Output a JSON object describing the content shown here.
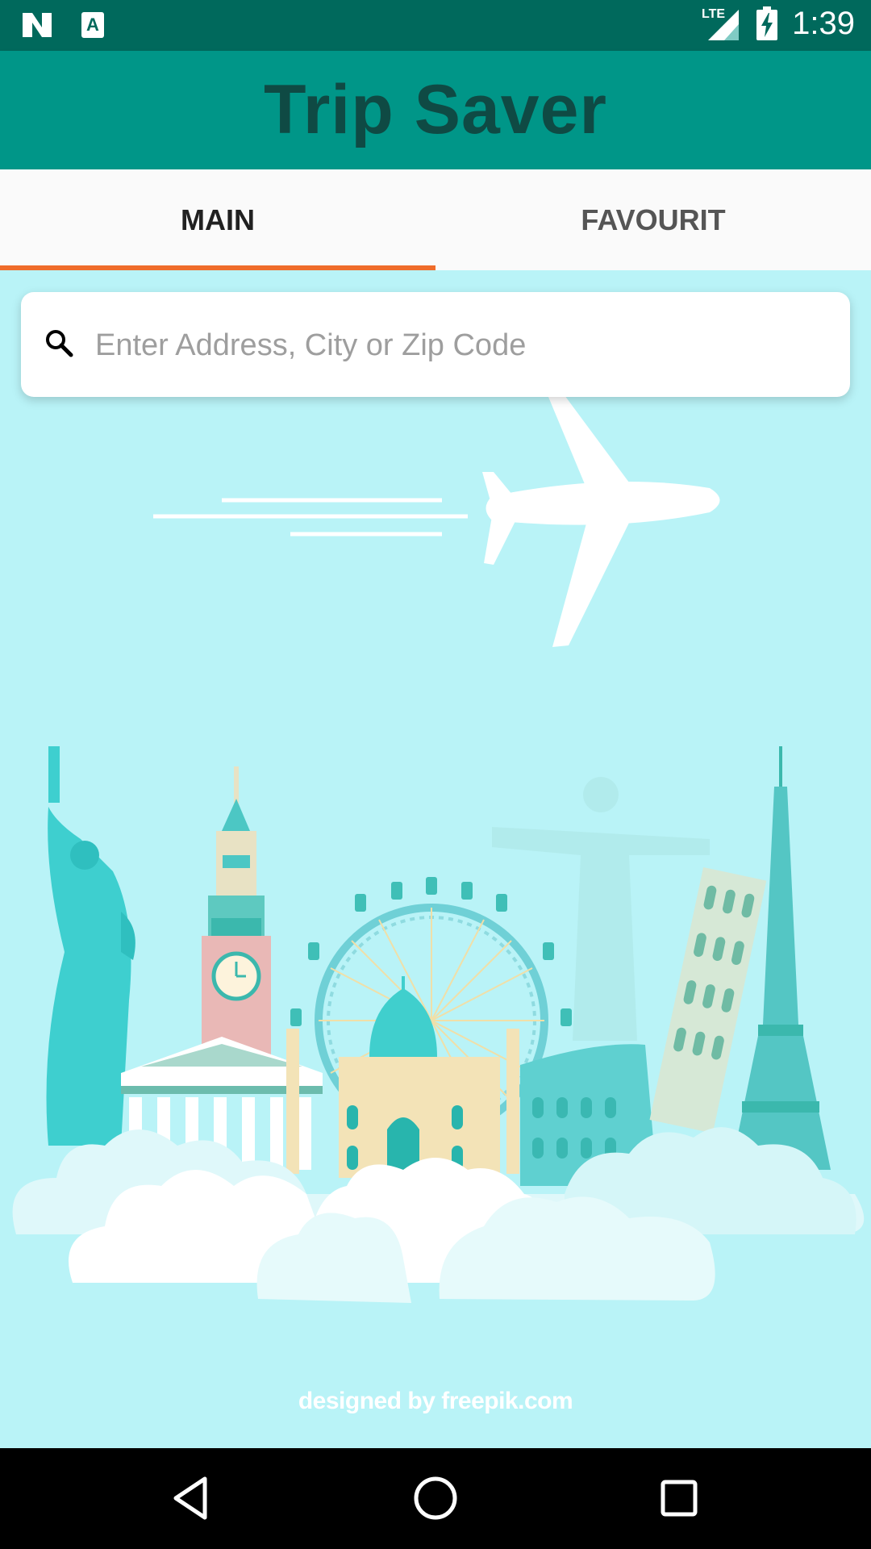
{
  "status_bar": {
    "time": "1:39",
    "network": "LTE",
    "icons": [
      "n-logo-icon",
      "a-app-icon",
      "signal-icon",
      "battery-charging-icon"
    ]
  },
  "app_bar": {
    "title": "Trip Saver"
  },
  "tabs": [
    {
      "label": "MAIN",
      "active": true
    },
    {
      "label": "FAVOURIT",
      "active": false
    }
  ],
  "search": {
    "placeholder": "Enter Address, City or Zip Code",
    "value": ""
  },
  "illustration": {
    "credit": "designed by freepik.com",
    "landmarks": [
      "statue-of-liberty",
      "big-ben",
      "parthenon",
      "london-eye",
      "taj-mahal",
      "christ-the-redeemer",
      "colosseum",
      "leaning-tower-of-pisa",
      "eiffel-tower"
    ]
  },
  "nav_bar": {
    "buttons": [
      "back-icon",
      "home-icon",
      "recents-icon"
    ]
  },
  "colors": {
    "status": "#00695c",
    "app_bar": "#009688",
    "accent": "#ef6c2a",
    "background": "#b9f3f7"
  }
}
